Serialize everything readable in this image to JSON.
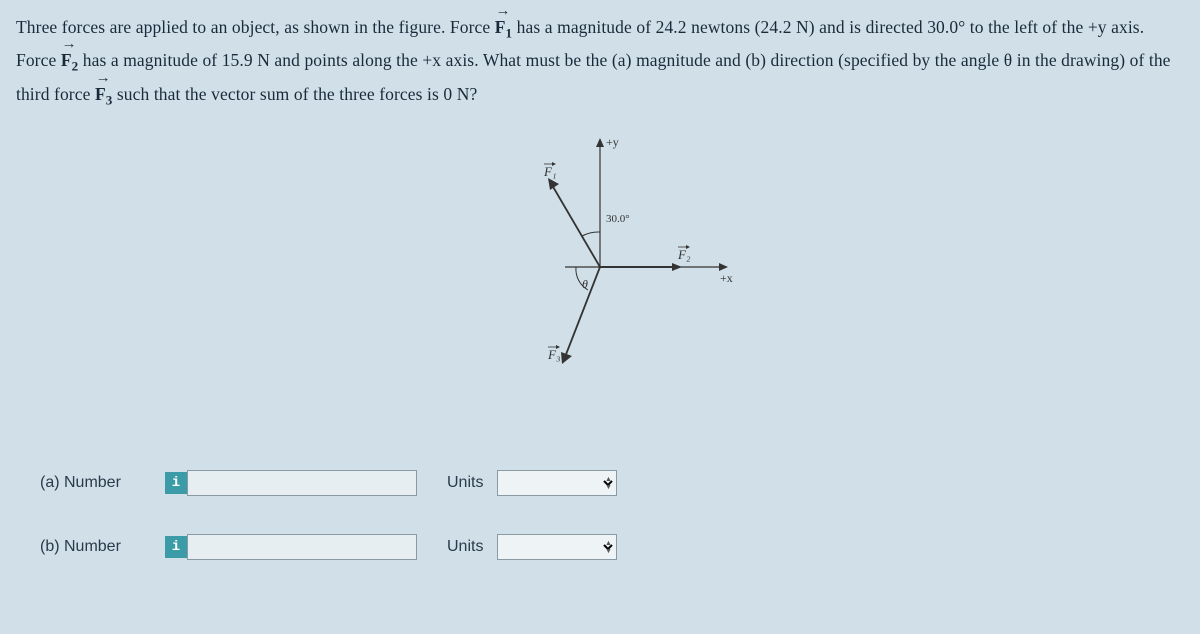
{
  "problem": {
    "p1_a": "Three forces are applied to an object, as shown in the figure. Force ",
    "p1_vec1": "F",
    "p1_sub1": "1",
    "p1_b": " has a magnitude of 24.2 newtons (24.2 N) and is directed 30.0° to the left of the +y axis. Force ",
    "p1_vec2": "F",
    "p1_sub2": "2",
    "p1_c": " has a magnitude of 15.9 N and points along the +x axis. What must be the (a) magnitude and (b) direction (specified by the angle θ in the drawing) of the third force ",
    "p1_vec3": "F",
    "p1_sub3": "3",
    "p1_d": " such that the vector sum of the three forces is 0 N?"
  },
  "diagram": {
    "plus_y": "+y",
    "plus_x": "+x",
    "angle": "30.0°",
    "theta": "θ",
    "F1": "F₁",
    "F2": "F₂",
    "F3": "F₃",
    "arrow_label_F1": "F",
    "arrow_label_F2": "F",
    "arrow_label_F3": "F"
  },
  "answers": {
    "a_label": "(a)   Number",
    "b_label": "(b)   Number",
    "units_label": "Units",
    "info": "i",
    "a_value": "",
    "b_value": "",
    "a_units": "",
    "b_units": ""
  }
}
